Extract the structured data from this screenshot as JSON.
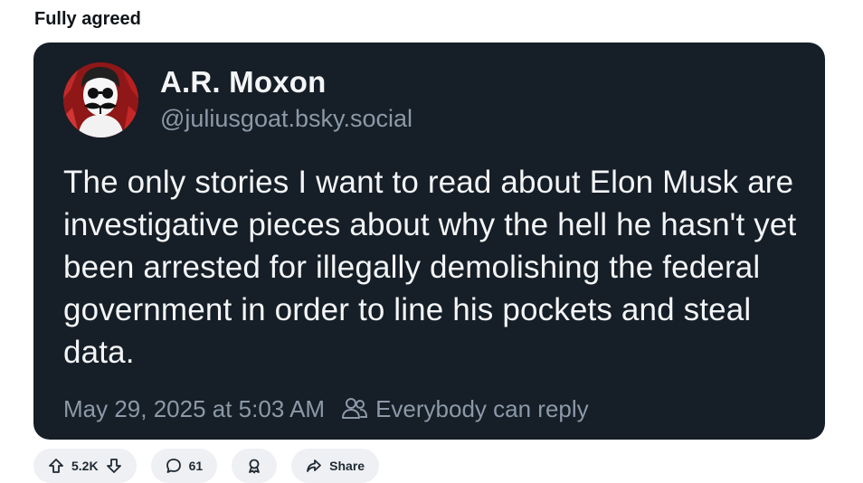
{
  "post": {
    "title": "Fully agreed"
  },
  "card": {
    "author_name": "A.R. Moxon",
    "author_handle": "@juliusgoat.bsky.social",
    "text": "The only stories I want to read about Elon Musk are investigative pieces about why the hell he hasn't yet been arrested for illegally demolishing the federal government in order to line his pockets and steal data.",
    "timestamp": "May 29, 2025 at 5:03 AM",
    "reply_setting": "Everybody can reply",
    "background_color": "#161e27",
    "secondary_text_color": "#8b99a8"
  },
  "actions": {
    "vote_count": "5.2K",
    "comment_count": "61",
    "share_label": "Share",
    "icons": [
      "upvote-arrow-icon",
      "downvote-arrow-icon",
      "comment-bubble-icon",
      "award-ribbon-icon",
      "share-arrow-icon"
    ]
  }
}
